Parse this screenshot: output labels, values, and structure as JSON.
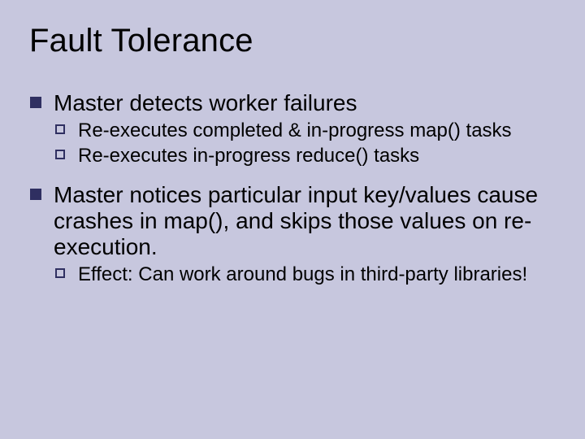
{
  "title": "Fault Tolerance",
  "bullets": [
    {
      "text": "Master detects worker failures",
      "sub": [
        "Re-executes completed & in-progress map() tasks",
        "Re-executes in-progress reduce() tasks"
      ]
    },
    {
      "text": "Master notices particular input key/values cause crashes in map(), and skips those values on re-execution.",
      "sub": [
        "Effect: Can work around bugs in third-party libraries!"
      ]
    }
  ]
}
